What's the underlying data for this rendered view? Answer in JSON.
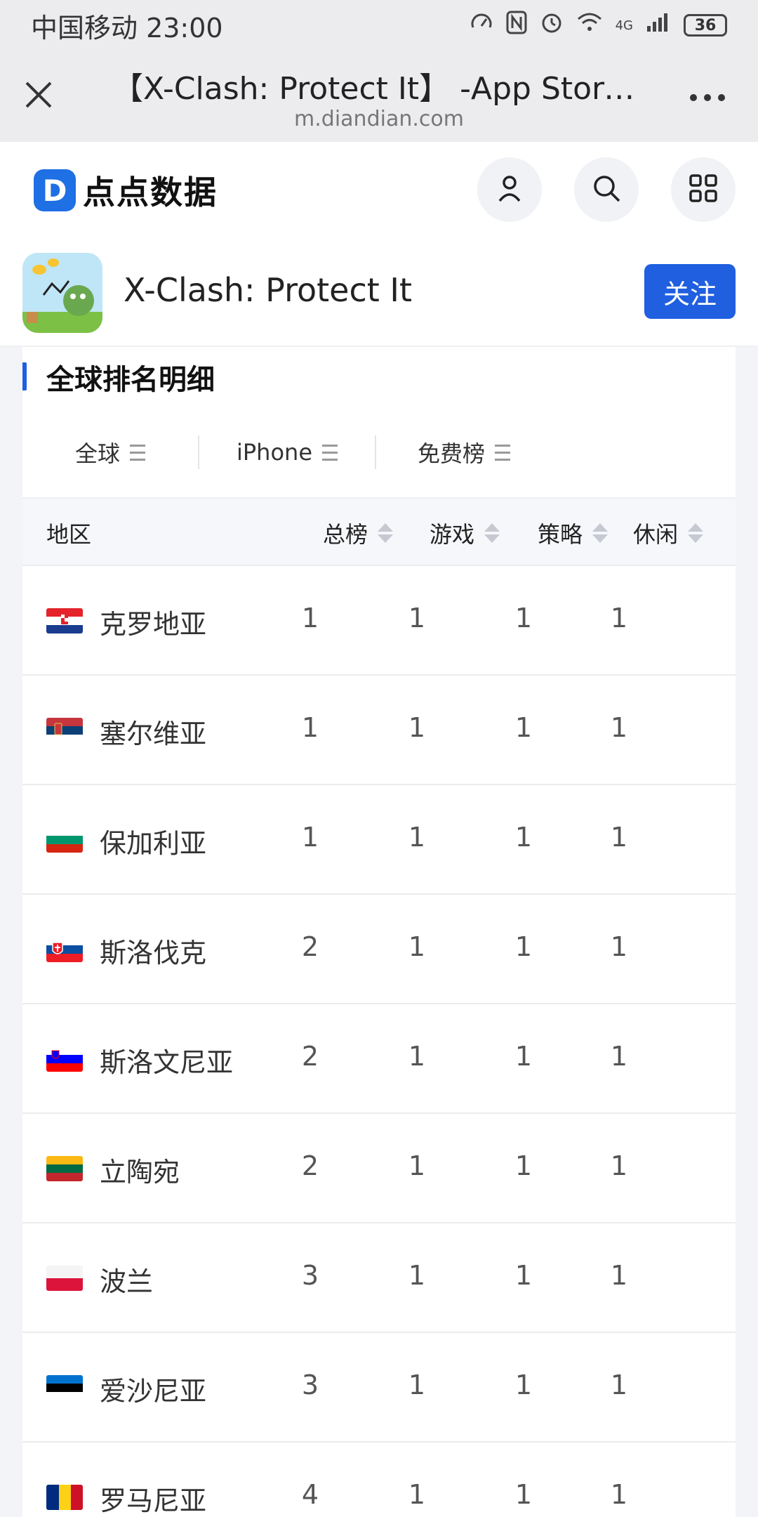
{
  "status_bar": {
    "carrier_time": "中国移动 23:00",
    "network": "4G",
    "battery": "36"
  },
  "browser": {
    "title": "【X-Clash: Protect It】 -App Store…",
    "url": "m.diandian.com"
  },
  "site": {
    "logo_text": "点点数据",
    "logo_mark": "D"
  },
  "app": {
    "name": "X-Clash: Protect It",
    "follow_label": "关注"
  },
  "section": {
    "title": "全球排名明细"
  },
  "filters": [
    {
      "label": "全球"
    },
    {
      "label": "iPhone"
    },
    {
      "label": "免费榜"
    }
  ],
  "table": {
    "headers": {
      "region": "地区",
      "overall": "总榜",
      "games": "游戏",
      "strategy": "策略",
      "casual": "休闲"
    },
    "rows": [
      {
        "region": "克罗地亚",
        "flag": "croatia",
        "overall": "1",
        "games": "1",
        "strategy": "1",
        "casual": "1"
      },
      {
        "region": "塞尔维亚",
        "flag": "serbia",
        "overall": "1",
        "games": "1",
        "strategy": "1",
        "casual": "1"
      },
      {
        "region": "保加利亚",
        "flag": "bulgaria",
        "overall": "1",
        "games": "1",
        "strategy": "1",
        "casual": "1"
      },
      {
        "region": "斯洛伐克",
        "flag": "slovakia",
        "overall": "2",
        "games": "1",
        "strategy": "1",
        "casual": "1"
      },
      {
        "region": "斯洛文尼亚",
        "flag": "slovenia",
        "overall": "2",
        "games": "1",
        "strategy": "1",
        "casual": "1"
      },
      {
        "region": "立陶宛",
        "flag": "lithuania",
        "overall": "2",
        "games": "1",
        "strategy": "1",
        "casual": "1"
      },
      {
        "region": "波兰",
        "flag": "poland",
        "overall": "3",
        "games": "1",
        "strategy": "1",
        "casual": "1"
      },
      {
        "region": "爱沙尼亚",
        "flag": "estonia",
        "overall": "3",
        "games": "1",
        "strategy": "1",
        "casual": "1"
      },
      {
        "region": "罗马尼亚",
        "flag": "romania",
        "overall": "4",
        "games": "1",
        "strategy": "1",
        "casual": "1"
      }
    ]
  },
  "colors": {
    "accent": "#1f5fe0",
    "background": "#f3f4f8"
  }
}
